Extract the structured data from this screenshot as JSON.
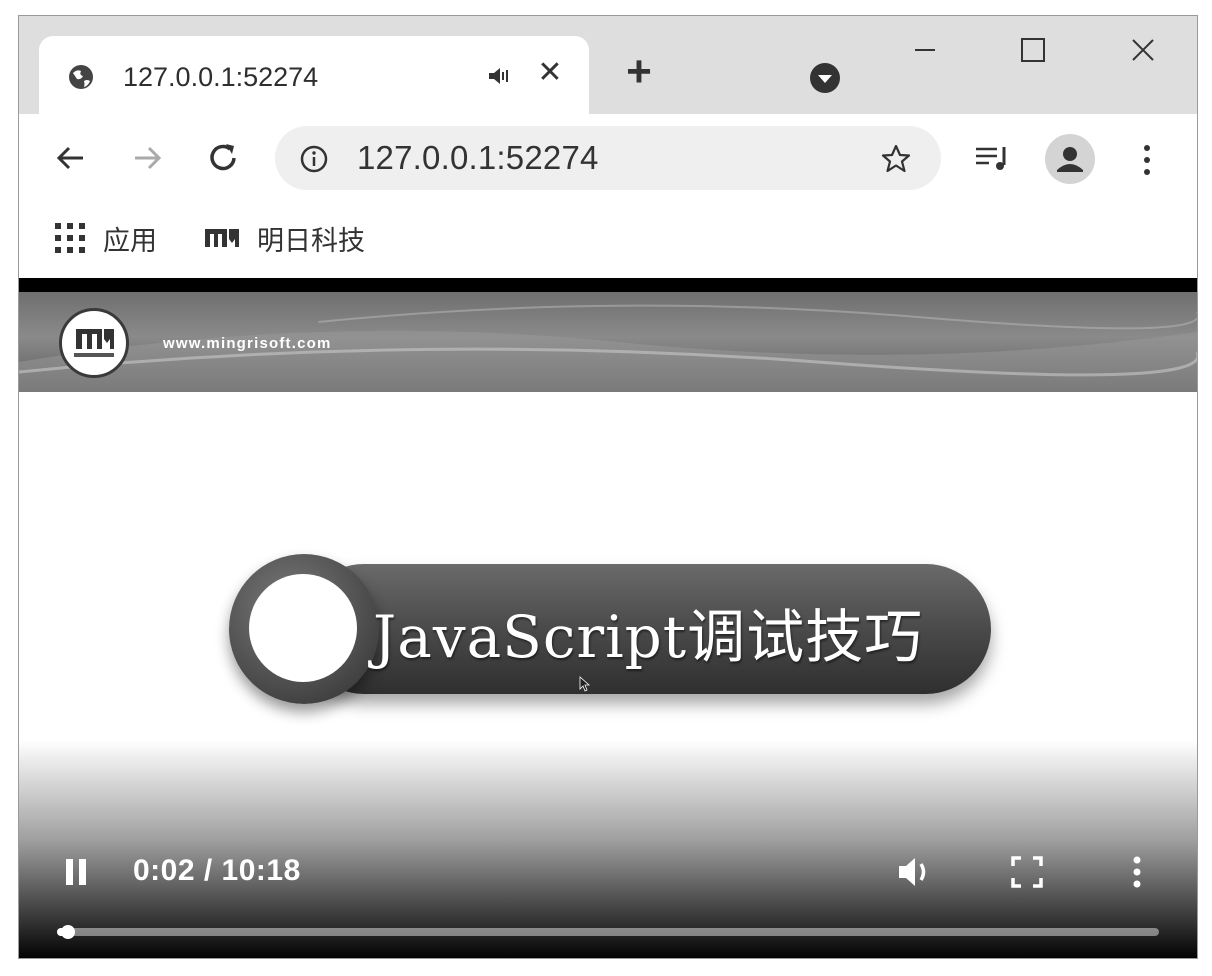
{
  "browser": {
    "tab": {
      "title": "127.0.0.1:52274",
      "favicon": "globe-icon",
      "audio_icon": "speaker-icon",
      "close_glyph": "✕"
    },
    "new_tab_glyph": "+",
    "address_bar": {
      "url": "127.0.0.1:52274",
      "info_icon": "info-icon",
      "bookmark_icon": "star-icon"
    },
    "bookmarks": [
      {
        "label": "应用",
        "icon": "apps-grid-icon"
      },
      {
        "label": "明日科技",
        "icon": "mingri-logo-icon"
      }
    ]
  },
  "video": {
    "banner_url": "www.mingrisoft.com",
    "title": "JavaScript调试技巧",
    "controls": {
      "time": "0:02 / 10:18",
      "progress": 0.004
    }
  },
  "colors": {
    "tabstrip": "#dedede",
    "omnibox": "#efefef",
    "banner": "#6f6f6f"
  }
}
